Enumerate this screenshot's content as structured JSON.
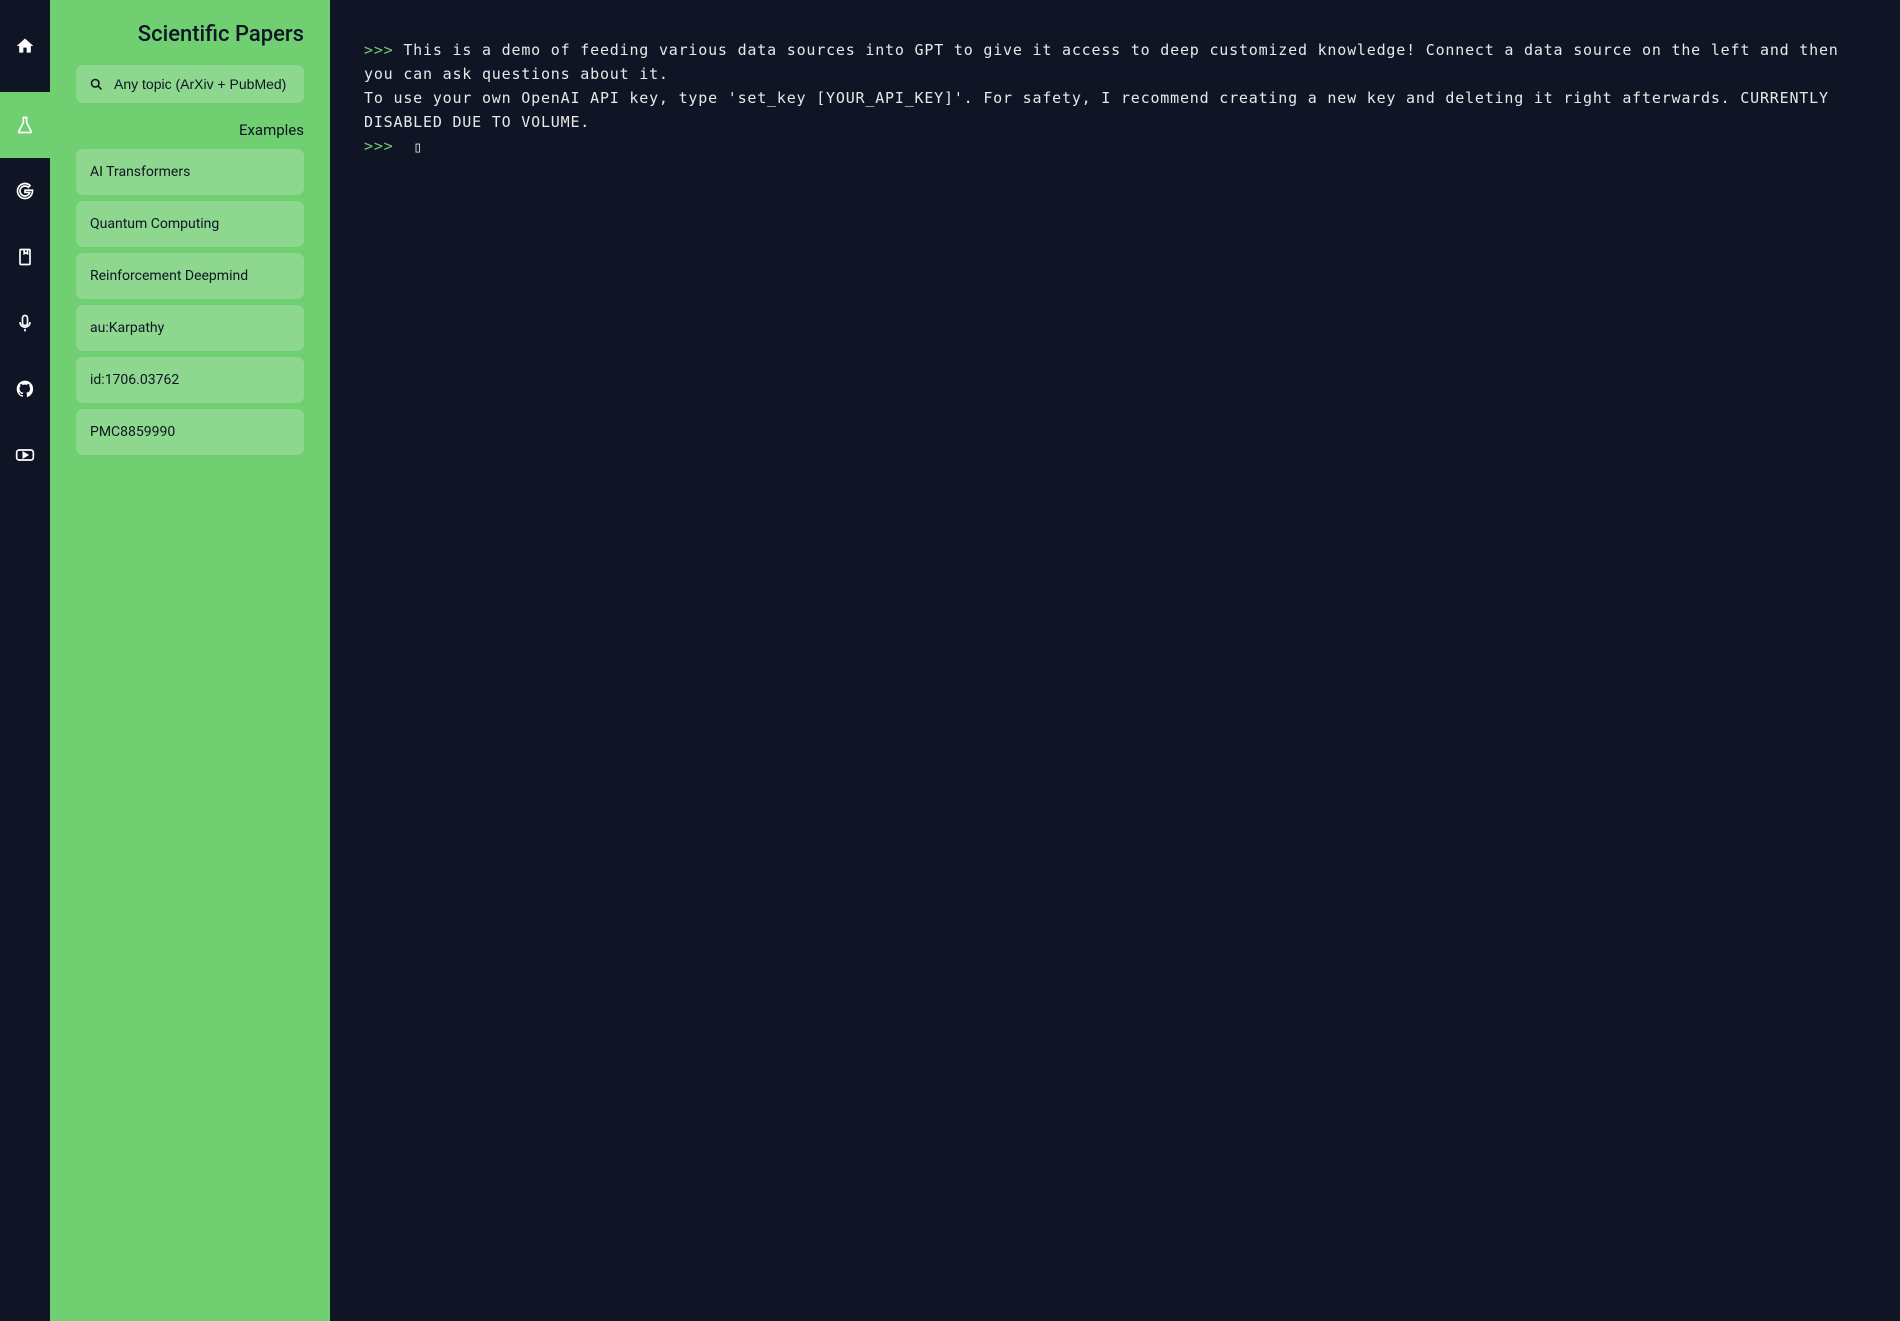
{
  "rail": {
    "items": [
      {
        "name": "home-icon"
      },
      {
        "name": "flask-icon",
        "active": true
      },
      {
        "name": "google-icon"
      },
      {
        "name": "bookmark-icon"
      },
      {
        "name": "mic-icon"
      },
      {
        "name": "github-icon"
      },
      {
        "name": "youtube-icon"
      }
    ]
  },
  "sidebar": {
    "title": "Scientific Papers",
    "search_placeholder": "Any topic (ArXiv + PubMed)",
    "examples_label": "Examples",
    "examples": [
      "AI Transformers",
      "Quantum Computing",
      "Reinforcement Deepmind",
      "au:Karpathy",
      "id:1706.03762",
      "PMC8859990"
    ]
  },
  "terminal": {
    "prompt": ">>>",
    "welcome_text": "This is a demo of feeding various data sources into GPT to give it access to deep customized knowledge! Connect a data source on the left and then you can ask questions about it.\nTo use your own OpenAI API key, type 'set_key [YOUR_API_KEY]'. For safety, I recommend creating a new key and deleting it right afterwards. CURRENTLY DISABLED DUE TO VOLUME.",
    "input_value": ""
  }
}
